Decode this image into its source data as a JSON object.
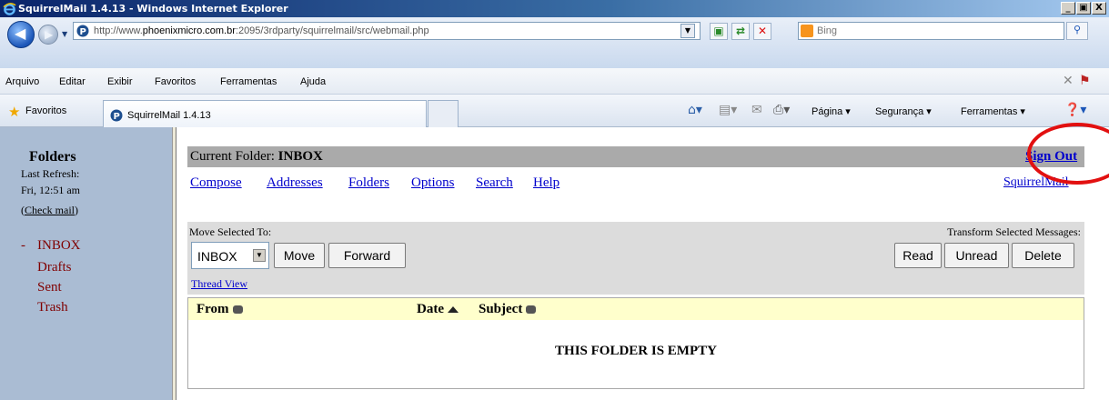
{
  "window": {
    "title": "SquirrelMail 1.4.13 - Windows Internet Explorer",
    "minimize": "_",
    "restore": "▣",
    "close": "X"
  },
  "address_bar": {
    "url_prefix": "http://www.",
    "url_domain": "phoenixmicro.com.br",
    "url_rest": ":2095/3rdparty/squirrelmail/src/webmail.php",
    "search_placeholder": "Bing"
  },
  "menu": {
    "items": [
      "Arquivo",
      "Editar",
      "Exibir",
      "Favoritos",
      "Ferramentas",
      "Ajuda"
    ]
  },
  "favorites_bar": {
    "favorites_label": "Favoritos",
    "tab_title": "SquirrelMail 1.4.13",
    "commands": [
      "Página ▾",
      "Segurança ▾",
      "Ferramentas ▾"
    ]
  },
  "left_frame": {
    "title": "Folders",
    "last_refresh_label": "Last Refresh:",
    "last_refresh_time": "Fri, 12:51 am",
    "check_mail_open": "(",
    "check_mail": "Check mail",
    "check_mail_close": ")",
    "current_marker": "-",
    "folders": [
      "INBOX",
      "Drafts",
      "Sent",
      "Trash"
    ]
  },
  "right_frame": {
    "current_folder_label": "Current Folder:",
    "current_folder": "INBOX",
    "sign_out": "Sign Out",
    "nav_links": [
      "Compose",
      "Addresses",
      "Folders",
      "Options",
      "Search",
      "Help"
    ],
    "squirrelmail_link": "SquirrelMail",
    "move_selected_label": "Move Selected To:",
    "transform_label": "Transform Selected Messages:",
    "move_target": "INBOX",
    "move_button": "Move",
    "forward_button": "Forward",
    "read_button": "Read",
    "unread_button": "Unread",
    "delete_button": "Delete",
    "thread_view": "Thread View",
    "columns": [
      "From",
      "Date",
      "Subject"
    ],
    "empty_message": "THIS FOLDER IS EMPTY"
  },
  "annotation_color": "#e21010"
}
